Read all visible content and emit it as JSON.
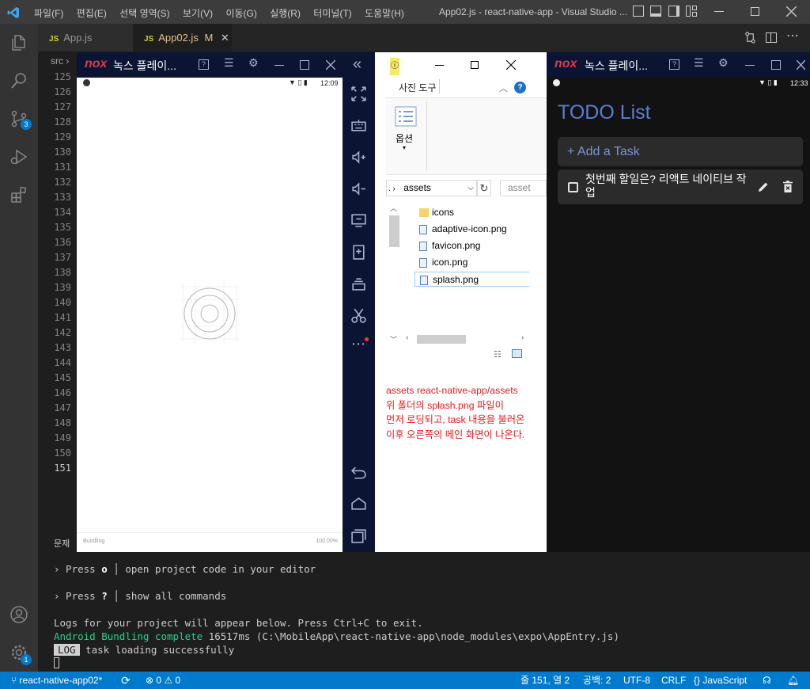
{
  "titlebar": {
    "menus": [
      "파일(F)",
      "편집(E)",
      "선택 영역(S)",
      "보기(V)",
      "이동(G)",
      "실행(R)",
      "터미널(T)",
      "도움말(H)"
    ],
    "title": "App02.js - react-native-app - Visual Studio ..."
  },
  "tabs": [
    {
      "icon": "JS",
      "label": "App.js"
    },
    {
      "icon": "JS",
      "label": "App02.js",
      "badge": "M"
    }
  ],
  "breadcrumb": "src",
  "scm_badge": "3",
  "settings_badge": "1",
  "line_numbers": [
    "125",
    "126",
    "127",
    "128",
    "129",
    "130",
    "131",
    "132",
    "133",
    "134",
    "135",
    "136",
    "137",
    "138",
    "139",
    "140",
    "141",
    "142",
    "143",
    "144",
    "145",
    "146",
    "147",
    "148",
    "149",
    "150",
    "151"
  ],
  "problems_tab": "문제",
  "nox_left": {
    "brand": "nox",
    "title": "녹스 플레이...",
    "time": "12:09",
    "footer_left": "Bundling",
    "footer_right": "100.00%"
  },
  "explorer": {
    "tab": "사진 도구",
    "ribbon_option": "옵션",
    "path": "assets",
    "search_placeholder": "asset",
    "files": [
      {
        "name": "icons",
        "type": "folder"
      },
      {
        "name": "adaptive-icon.png",
        "type": "png"
      },
      {
        "name": "favicon.png",
        "type": "png"
      },
      {
        "name": "icon.png",
        "type": "png"
      },
      {
        "name": "splash.png",
        "type": "png",
        "selected": true
      }
    ],
    "annotation_lines": [
      "assets react-native-app/assets",
      "위 폴더의 splash.png 파일이",
      "먼저 로딩되고, task 내용을 불러온",
      "이후 오른쪽의 메인 화면이 나온다."
    ]
  },
  "nox_right": {
    "brand": "nox",
    "title": "녹스 플레이...",
    "time": "12:33",
    "app_title": "TODO List",
    "add_task": "+ Add a Task",
    "task_text": "첫번째 할일은? 리액트 네이티브 작업"
  },
  "terminal": {
    "line1_prefix": "› Press ",
    "line1_key": "o",
    "line1_sep": " │ ",
    "line1_text": "open project code in your editor",
    "line2_prefix": "› Press ",
    "line2_key": "?",
    "line2_sep": " │ ",
    "line2_text": "show all commands",
    "logs_line": "Logs for your project will appear below. Press Ctrl+C to exit.",
    "bundle_platform": "Android",
    "bundle_status": "Bundling complete",
    "bundle_time": "16517ms",
    "bundle_path": "(C:\\MobileApp\\react-native-app\\node_modules\\expo\\AppEntry.js)",
    "log_tag": "LOG",
    "log_text": "task loading successfully"
  },
  "statusbar": {
    "branch": "react-native-app02*",
    "errors": "0",
    "warnings": "0",
    "position": "줄 151, 열 2",
    "spaces": "공백: 2",
    "encoding": "UTF-8",
    "eol": "CRLF",
    "language": "JavaScript"
  },
  "colors": {
    "vscode_accent": "#007acc",
    "nox_bar": "#0b1533",
    "todo_accent": "#5c7cd6",
    "annotation_red": "#e02020"
  }
}
